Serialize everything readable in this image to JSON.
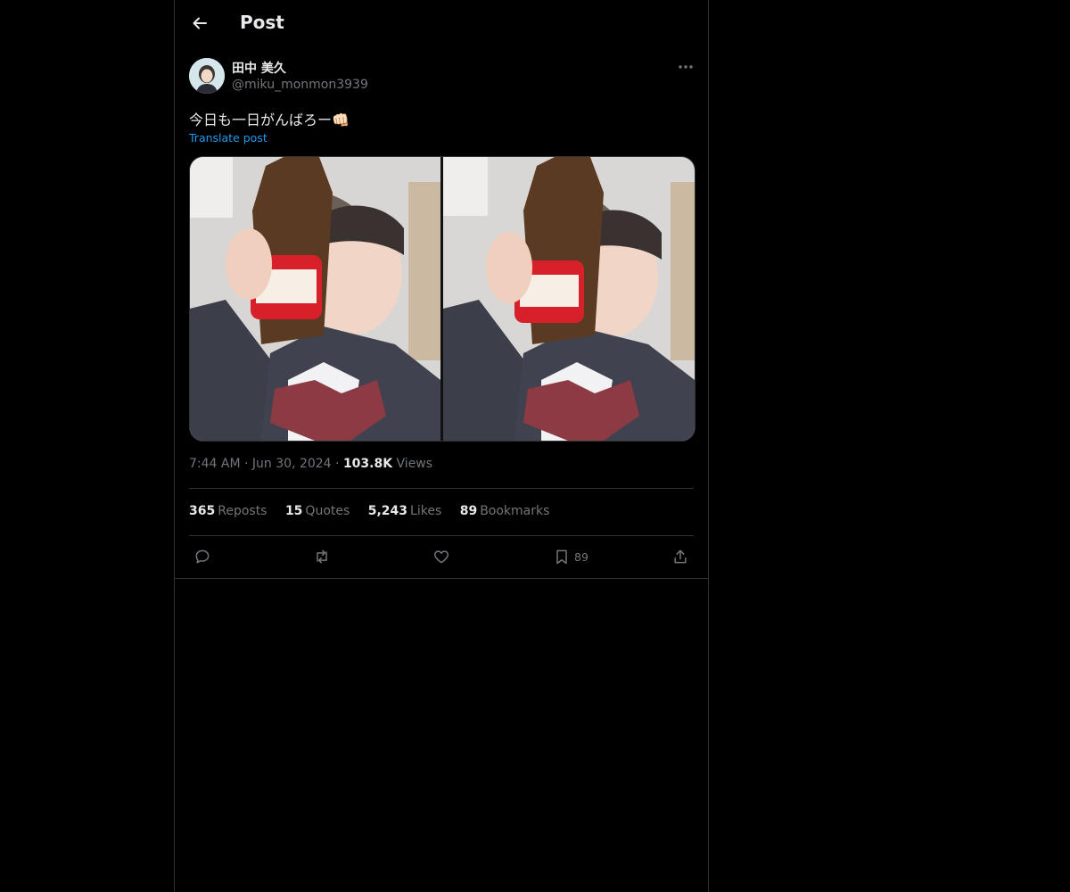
{
  "header": {
    "title": "Post",
    "back_icon": "arrow-left-icon"
  },
  "author": {
    "name": "田中 美久",
    "handle": "@miku_monmon3939",
    "more_icon": "more-horizontal-icon"
  },
  "post": {
    "text": "今日も一日がんばろー👊🏻",
    "translate_label": "Translate post",
    "media_count": 2
  },
  "meta": {
    "time": "7:44 AM",
    "date": "Jun 30, 2024",
    "views_count": "103.8K",
    "views_label": "Views"
  },
  "stats": {
    "reposts_count": "365",
    "reposts_label": "Reposts",
    "quotes_count": "15",
    "quotes_label": "Quotes",
    "likes_count": "5,243",
    "likes_label": "Likes",
    "bookmarks_count": "89",
    "bookmarks_label": "Bookmarks"
  },
  "actions": {
    "reply_icon": "reply-icon",
    "repost_icon": "repost-icon",
    "like_icon": "heart-icon",
    "bookmark_icon": "bookmark-icon",
    "bookmark_count": "89",
    "share_icon": "share-icon"
  },
  "colors": {
    "background": "#000000",
    "border": "#2f3336",
    "text": "#e7e9ea",
    "muted": "#71767b",
    "link": "#1d9bf0"
  }
}
